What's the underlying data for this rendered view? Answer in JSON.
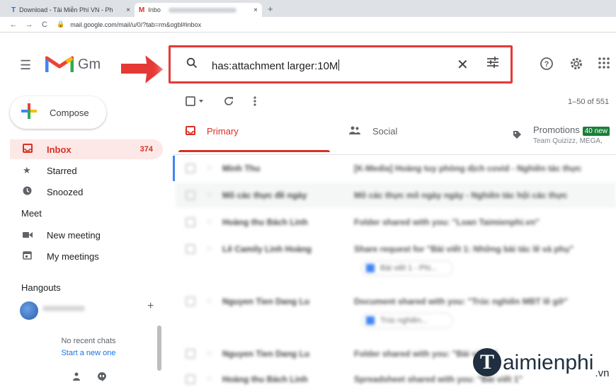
{
  "browser": {
    "tabs": [
      {
        "favicon": "T",
        "title": "Download - Tải Miễn Phí VN - Ph",
        "close": "×"
      },
      {
        "favicon": "M",
        "title": "Inbo",
        "close": "×"
      }
    ],
    "new_tab": "+",
    "back": "←",
    "forward": "→",
    "reload": "C",
    "url": "mail.google.com/mail/u/0/?tab=rm&ogbl#inbox"
  },
  "gmail": {
    "logo_word": "Gm",
    "search": {
      "query": "has:attachment larger:10M"
    },
    "compose_label": "Compose",
    "nav": [
      {
        "label": "Inbox",
        "count": "374",
        "icon": "inbox-icon"
      },
      {
        "label": "Starred",
        "count": "",
        "icon": "star-icon"
      },
      {
        "label": "Snoozed",
        "count": "",
        "icon": "clock-icon"
      }
    ],
    "meet": {
      "title": "Meet",
      "items": [
        {
          "label": "New meeting",
          "icon": "video-icon"
        },
        {
          "label": "My meetings",
          "icon": "calendar-icon"
        }
      ]
    },
    "hangouts": {
      "title": "Hangouts",
      "no_chats": "No recent chats",
      "start_new": "Start a new one"
    },
    "toolbar": {
      "range": "1–50 of 551"
    },
    "categories": {
      "primary": "Primary",
      "social": "Social",
      "promotions": "Promotions",
      "promotions_badge": "40 new",
      "promotions_sub": "Team Quizizz, MEGA,"
    },
    "rows": [
      {
        "sender": "Minh Thu",
        "subject": "[K-Media] Hoàng tuy phòng dịch covid - Nghiên tác thực"
      },
      {
        "sender": "Mô các thực đề ngày",
        "subject": "Mô các thực mô ngày ngày - Nghiên tác hội các thực"
      },
      {
        "sender": "Hoàng thu Bách Linh",
        "subject": "Folder shared with you: \"Loan Taimienphi.vn\""
      },
      {
        "sender": "Lê Camily Linh Hoàng",
        "subject": "Share request for \"Bài viết 1: Những bài tác lê và phụ\"",
        "chip": "Bài viết 1 - Phi..."
      },
      {
        "sender": "Nguyen Tien Dang Lu",
        "subject": "Document shared with you: \"Trúc nghiên MBT lê gỡ\"",
        "chip": "Trúc nghiên..."
      },
      {
        "sender": "Nguyen Tien Dang Lu",
        "subject": "Folder shared with you: \"Bài viết 1\""
      },
      {
        "sender": "Hoàng thu Bách Linh",
        "subject": "Spreadsheet shared with you: \"Bài viết 1\""
      }
    ]
  },
  "watermark": {
    "letter": "T",
    "text": "aimienphi",
    "suffix": ".vn"
  }
}
